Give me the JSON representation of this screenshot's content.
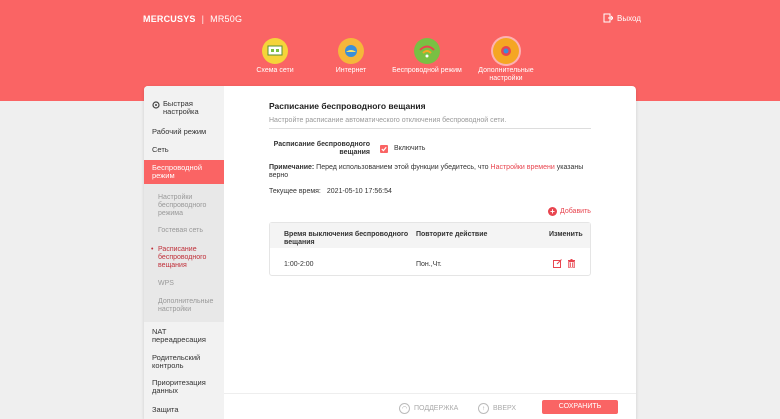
{
  "header": {
    "brand": "MERCUSYS",
    "separator": "|",
    "model": "MR50G",
    "logout_label": "Выход"
  },
  "nav": [
    {
      "label": "Схема сети",
      "icon": "network-map-icon",
      "color": "#f5d43a"
    },
    {
      "label": "Интернет",
      "icon": "globe-icon",
      "color": "#f5b73a"
    },
    {
      "label": "Беспроводной режим",
      "icon": "wifi-icon",
      "color": "#79c043"
    },
    {
      "label": "Дополнительные настройки",
      "icon": "gear-icon",
      "color": "#f5a623"
    }
  ],
  "sidebar": {
    "items": [
      {
        "label": "Быстрая настройка"
      },
      {
        "label": "Рабочий режим"
      },
      {
        "label": "Сеть"
      },
      {
        "label": "Беспроводной режим"
      },
      {
        "label": "NAT переадресация"
      },
      {
        "label": "Родительский контроль"
      },
      {
        "label": "Приоритезация данных"
      },
      {
        "label": "Защита"
      }
    ],
    "subitems": [
      {
        "label": "Настройки беспроводного режима"
      },
      {
        "label": "Гостевая сеть"
      },
      {
        "label": "Расписание беспроводного вещания"
      },
      {
        "label": "WPS"
      },
      {
        "label": "Дополнительные настройки"
      }
    ]
  },
  "main": {
    "title": "Расписание беспроводного вещания",
    "description": "Настройте расписание автоматического отключения беспроводной сети.",
    "schedule_label": "Расписание беспроводного вещания",
    "enable_label": "Включить",
    "note_prefix": "Примечание:",
    "note_text": " Перед использованием этой функции убедитесь, что ",
    "note_link": "Настройки времени",
    "note_suffix": " указаны верно",
    "current_time_label": "Текущее время:",
    "current_time_value": "2021-05-10 17:56:54",
    "add_label": "Добавить",
    "table": {
      "headers": [
        "Время выключения беспроводного вещания",
        "Повторите действие",
        "Изменить"
      ],
      "rows": [
        {
          "time": "1:00-2:00",
          "repeat": "Пон.,Чт."
        }
      ]
    }
  },
  "footer": {
    "support_label": "ПОДДЕРЖКА",
    "top_label": "ВВЕРХ",
    "save_label": "СОХРАНИТЬ"
  },
  "colors": {
    "accent": "#fa6464",
    "link": "#e8454f"
  }
}
